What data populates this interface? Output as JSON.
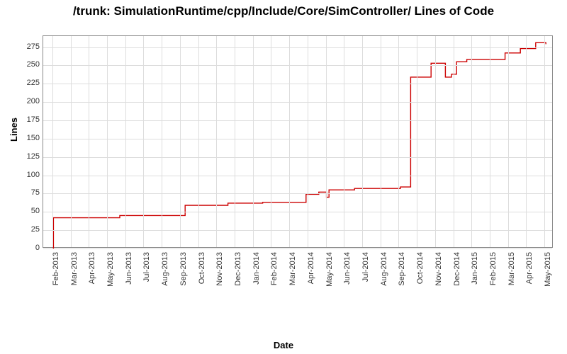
{
  "chart_data": {
    "type": "line",
    "title": "/trunk: SimulationRuntime/cpp/Include/Core/SimController/ Lines of Code",
    "xlabel": "Date",
    "ylabel": "Lines",
    "ylim": [
      0,
      290
    ],
    "xlim_fraction": [
      0,
      1
    ],
    "yticks": [
      0,
      25,
      50,
      75,
      100,
      125,
      150,
      175,
      200,
      225,
      250,
      275
    ],
    "xticks": [
      "Feb-2013",
      "Mar-2013",
      "Apr-2013",
      "May-2013",
      "Jun-2013",
      "Jul-2013",
      "Aug-2013",
      "Sep-2013",
      "Oct-2013",
      "Nov-2013",
      "Dec-2013",
      "Jan-2014",
      "Feb-2014",
      "Mar-2014",
      "Apr-2014",
      "May-2014",
      "Jun-2014",
      "Jul-2014",
      "Aug-2014",
      "Sep-2014",
      "Oct-2014",
      "Nov-2014",
      "Dec-2014",
      "Jan-2015",
      "Feb-2015",
      "Mar-2015",
      "Apr-2015",
      "May-2015"
    ],
    "series": [
      {
        "name": "Lines",
        "points": [
          {
            "xf": 0.02,
            "y": 0
          },
          {
            "xf": 0.02,
            "y": 42
          },
          {
            "xf": 0.15,
            "y": 42
          },
          {
            "xf": 0.15,
            "y": 45
          },
          {
            "xf": 0.278,
            "y": 45
          },
          {
            "xf": 0.278,
            "y": 59
          },
          {
            "xf": 0.362,
            "y": 59
          },
          {
            "xf": 0.362,
            "y": 62
          },
          {
            "xf": 0.43,
            "y": 62
          },
          {
            "xf": 0.43,
            "y": 63
          },
          {
            "xf": 0.515,
            "y": 63
          },
          {
            "xf": 0.515,
            "y": 74
          },
          {
            "xf": 0.54,
            "y": 74
          },
          {
            "xf": 0.54,
            "y": 77
          },
          {
            "xf": 0.555,
            "y": 77
          },
          {
            "xf": 0.555,
            "y": 70
          },
          {
            "xf": 0.56,
            "y": 70
          },
          {
            "xf": 0.56,
            "y": 80
          },
          {
            "xf": 0.61,
            "y": 80
          },
          {
            "xf": 0.61,
            "y": 82
          },
          {
            "xf": 0.7,
            "y": 82
          },
          {
            "xf": 0.7,
            "y": 84
          },
          {
            "xf": 0.72,
            "y": 84
          },
          {
            "xf": 0.72,
            "y": 234
          },
          {
            "xf": 0.76,
            "y": 234
          },
          {
            "xf": 0.76,
            "y": 253
          },
          {
            "xf": 0.788,
            "y": 253
          },
          {
            "xf": 0.788,
            "y": 234
          },
          {
            "xf": 0.8,
            "y": 234
          },
          {
            "xf": 0.8,
            "y": 238
          },
          {
            "xf": 0.81,
            "y": 238
          },
          {
            "xf": 0.81,
            "y": 255
          },
          {
            "xf": 0.83,
            "y": 255
          },
          {
            "xf": 0.83,
            "y": 258
          },
          {
            "xf": 0.905,
            "y": 258
          },
          {
            "xf": 0.905,
            "y": 267
          },
          {
            "xf": 0.935,
            "y": 267
          },
          {
            "xf": 0.935,
            "y": 273
          },
          {
            "xf": 0.965,
            "y": 273
          },
          {
            "xf": 0.965,
            "y": 281
          },
          {
            "xf": 0.985,
            "y": 281
          },
          {
            "xf": 0.985,
            "y": 279
          }
        ]
      }
    ]
  }
}
